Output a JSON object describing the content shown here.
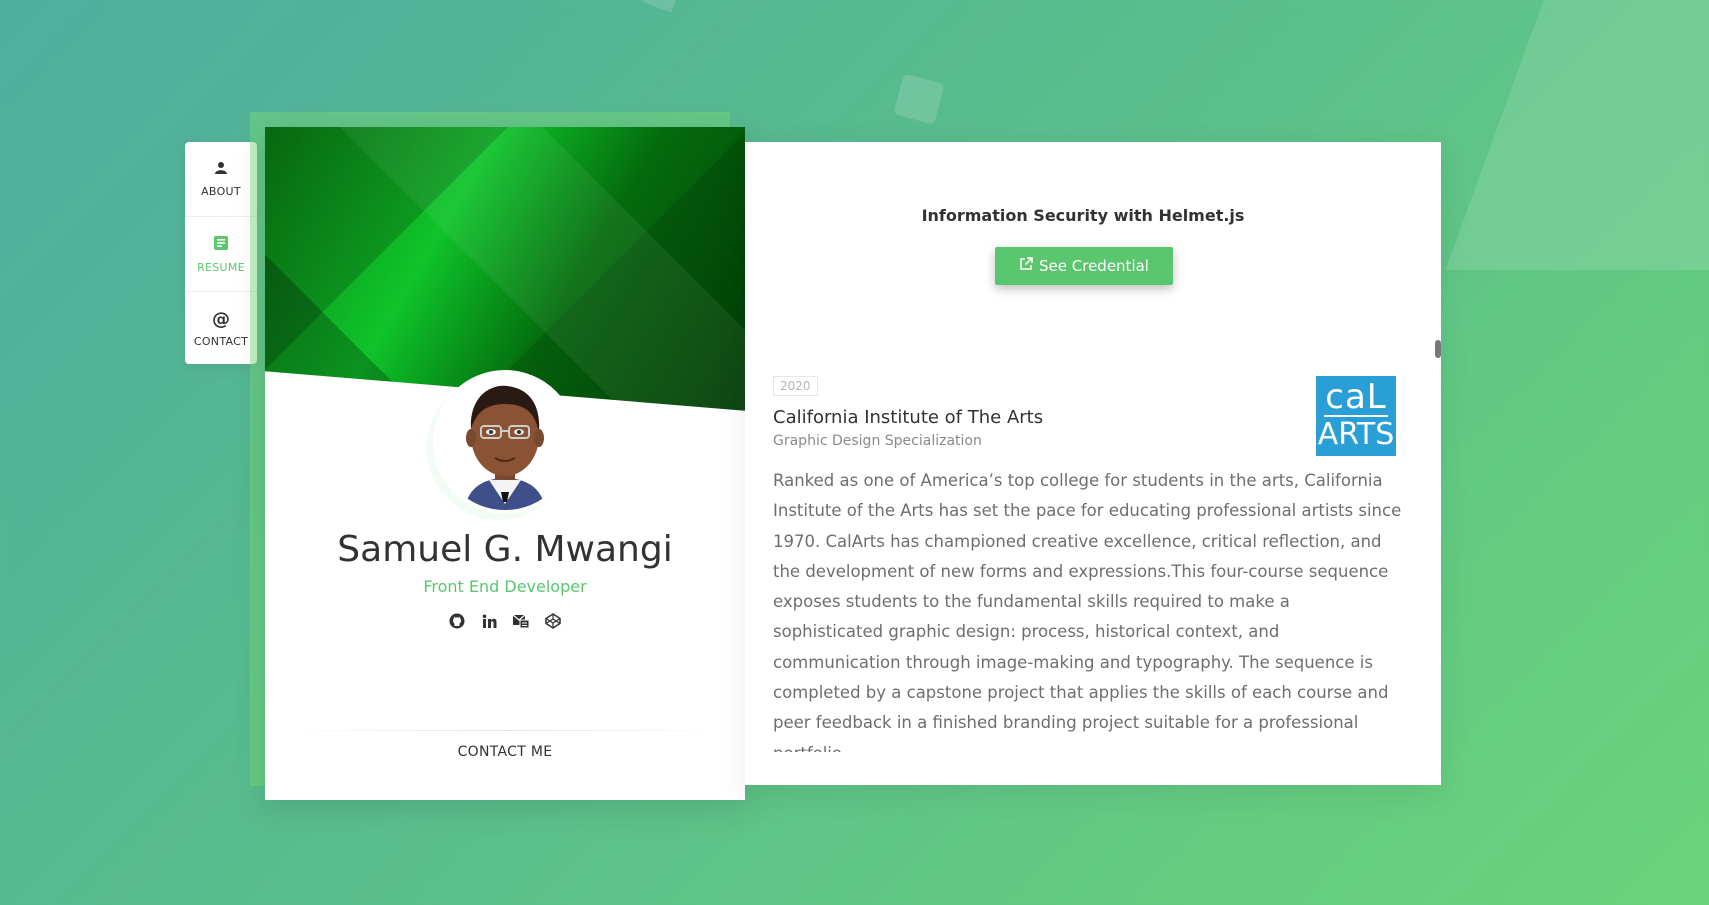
{
  "nav": {
    "items": [
      {
        "label": "ABOUT",
        "icon": "user-icon"
      },
      {
        "label": "RESUME",
        "icon": "document-icon",
        "active": true
      },
      {
        "label": "CONTACT",
        "icon": "at-icon"
      }
    ]
  },
  "profile": {
    "name": "Samuel G. Mwangi",
    "title": "Front End Developer",
    "socials": [
      "github-icon",
      "linkedin-icon",
      "mail-icon",
      "codepen-icon"
    ],
    "contact_label": "CONTACT ME"
  },
  "credential": {
    "title": "Information Security with Helmet.js",
    "button_label": "See Credential"
  },
  "education": {
    "year": "2020",
    "school": "California Institute of The Arts",
    "specialization": "Graphic Design Specialization",
    "logo_line1": "caL",
    "logo_line2": "ARTS",
    "description": "Ranked as one of America’s top college for students in the arts, California Institute of the Arts has set the pace for educating professional artists since 1970. CalArts has championed creative excellence, critical reflection, and the development of new forms and expressions.This four-course sequence exposes students to the fundamental skills required to make a sophisticated graphic design: process, historical context, and communication through image-making and typography. The sequence is completed by a capstone project that applies the skills of each course and peer feedback in a finished branding project suitable for a professional portfolio."
  },
  "colors": {
    "accent": "#5ac76e",
    "text": "#323232",
    "logo_bg": "#2a9fd6"
  }
}
